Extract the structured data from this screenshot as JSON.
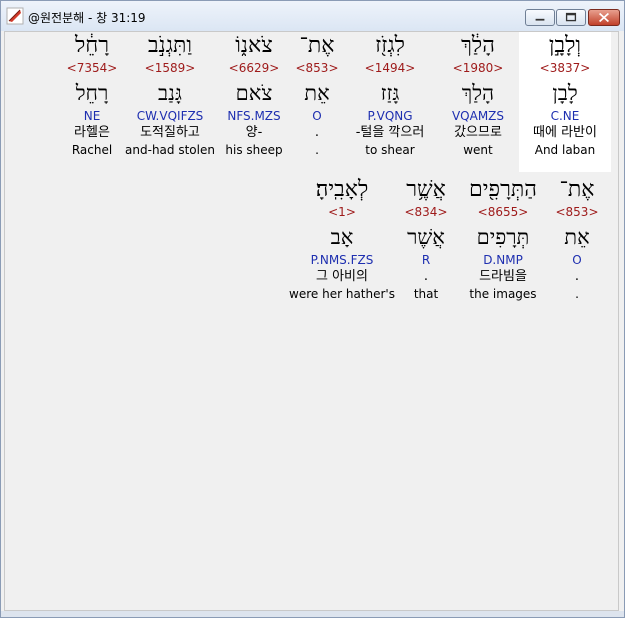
{
  "window": {
    "title": "@원전분해 - 창 31:19",
    "icon": "app-feather-icon"
  },
  "verse_rows": [
    [
      {
        "hebrew": "וְלָבָ֣ן",
        "strong": "<3837>",
        "lemma": "לָבָן",
        "parsing": "C.NE",
        "korean": "때에 라반이",
        "english": "And laban"
      },
      {
        "hebrew": "הָלַ֔ךְ",
        "strong": "<1980>",
        "lemma": "הָלַךְ",
        "parsing": "VQAMZS",
        "korean": "갔으므로",
        "english": "went"
      },
      {
        "hebrew": "לִגְזֹ֖ז",
        "strong": "<1494>",
        "lemma": "גָּזַז",
        "parsing": "P.VQNG",
        "korean": "-털을 깍으러",
        "english": "to shear"
      },
      {
        "hebrew": "אֶת־",
        "strong": "<853>",
        "lemma": "אֵת",
        "parsing": "O",
        "korean": ".",
        "english": "."
      },
      {
        "hebrew": "צֹאנ֑וֹ",
        "strong": "<6629>",
        "lemma": "צֹאם",
        "parsing": "NFS.MZS",
        "korean": "양-",
        "english": "his sheep"
      },
      {
        "hebrew": "וַתִּגְנֹ֣ב",
        "strong": "<1589>",
        "lemma": "גָּנַב",
        "parsing": "CW.VQIFZS",
        "korean": "도적질하고",
        "english": "and-had stolen"
      },
      {
        "hebrew": "רָחֵ֔ל",
        "strong": "<7354>",
        "lemma": "רָחֵל",
        "parsing": "NE",
        "korean": "라헬은",
        "english": "Rachel"
      }
    ],
    [
      {
        "hebrew": "אֶת־",
        "strong": "<853>",
        "lemma": "אֵת",
        "parsing": "O",
        "korean": ".",
        "english": "."
      },
      {
        "hebrew": "הַתְּרָפִ֖ים",
        "strong": "<8655>",
        "lemma": "תְּרָפִים",
        "parsing": "D.NMP",
        "korean": "드라빔을",
        "english": "the images"
      },
      {
        "hebrew": "אֲשֶׁ֥ר",
        "strong": "<834>",
        "lemma": "אֲשֶׁר",
        "parsing": "R",
        "korean": ".",
        "english": "that"
      },
      {
        "hebrew": "לְאָבִֽיהָ׃",
        "strong": "<1>",
        "lemma": "אָב",
        "parsing": "P.NMS.FZS",
        "korean": "그 아비의",
        "english": "were her hather's"
      }
    ]
  ]
}
